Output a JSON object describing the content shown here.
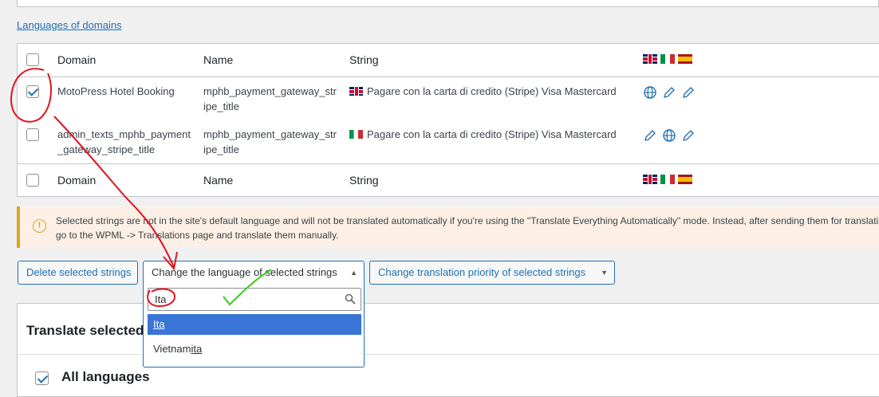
{
  "domains_link": "Languages of domains",
  "table": {
    "headers": {
      "domain": "Domain",
      "name": "Name",
      "string": "String"
    },
    "header_flags": [
      "uk-flag-icon",
      "italy-flag-icon",
      "spain-flag-icon"
    ],
    "rows": [
      {
        "checked": true,
        "domain": "MotoPress Hotel Booking",
        "name": "mphb_payment_gateway_stripe_title",
        "string_flag": "uk-flag-icon",
        "string": "Pagare con la carta di credito (Stripe) Visa Mastercard",
        "actions": [
          "globe-icon",
          "pencil-icon",
          "pencil-icon"
        ]
      },
      {
        "checked": false,
        "domain": "admin_texts_mphb_payment_gateway_stripe_title",
        "name": "mphb_payment_gateway_stripe_title",
        "string_flag": "italy-flag-icon",
        "string": "Pagare con la carta di credito (Stripe) Visa Mastercard",
        "actions": [
          "pencil-icon",
          "globe-icon",
          "pencil-icon"
        ]
      }
    ]
  },
  "notice": {
    "line1": "Selected strings are not in the site's default language and will not be translated automatically if you're using the \"Translate Everything Automatically\" mode. Instead, after sending them for translati",
    "line2": "go to the WPML -> Translations page and translate them manually."
  },
  "buttons": {
    "delete": "Delete selected strings",
    "change_language": "Change the language of selected strings",
    "change_priority": "Change translation priority of selected strings"
  },
  "dropdown": {
    "search_value": "Ita",
    "options": [
      {
        "label": "Ita",
        "selected": true
      },
      {
        "prefix": "Vietnam",
        "match": "ita",
        "selected": false
      }
    ]
  },
  "translate": {
    "title": "Translate selected s",
    "all_languages": "All languages"
  },
  "colors": {
    "accent": "#2271b1",
    "highlight": "#3875d7",
    "warning": "#dba617",
    "annotation_red": "#e0141e",
    "annotation_green": "#3ec81e"
  }
}
